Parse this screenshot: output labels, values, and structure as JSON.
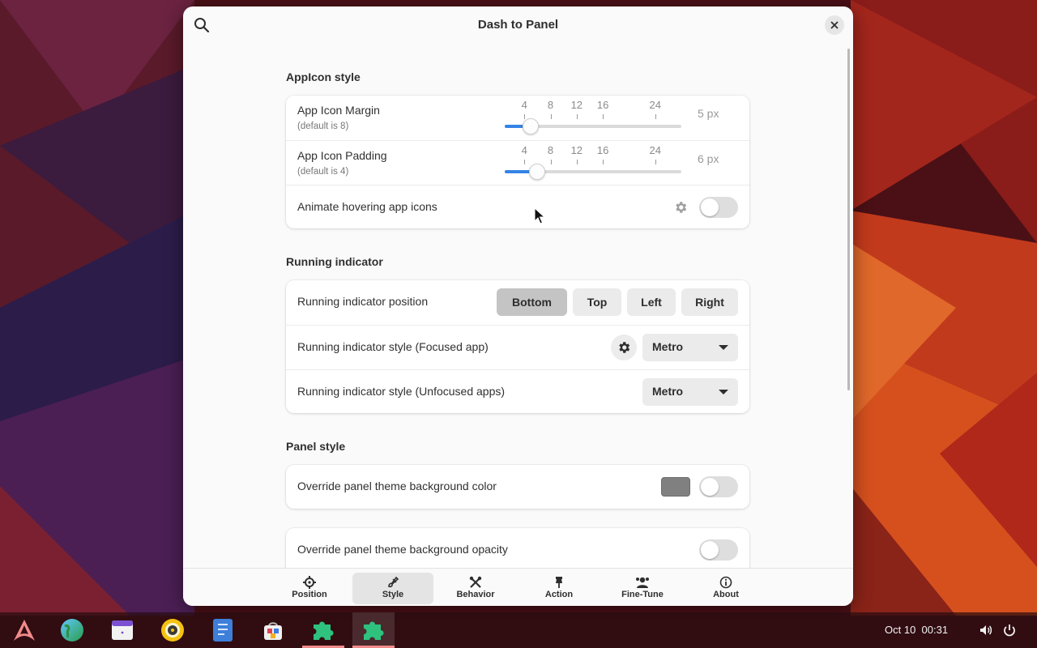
{
  "window": {
    "title": "Dash to Panel"
  },
  "appicon_style": {
    "heading": "AppIcon style",
    "margin": {
      "label": "App Icon Margin",
      "sub": "(default is 8)",
      "value_text": "5 px",
      "value": 5
    },
    "padding": {
      "label": "App Icon Padding",
      "sub": "(default is 4)",
      "value_text": "6 px",
      "value": 6
    },
    "ticks": [
      "4",
      "8",
      "12",
      "16",
      "24"
    ],
    "animate": {
      "label": "Animate hovering app icons",
      "enabled": false
    }
  },
  "running_indicator": {
    "heading": "Running indicator",
    "position": {
      "label": "Running indicator position",
      "options": [
        "Bottom",
        "Top",
        "Left",
        "Right"
      ],
      "selected": "Bottom"
    },
    "focused": {
      "label": "Running indicator style (Focused app)",
      "value": "Metro"
    },
    "unfocused": {
      "label": "Running indicator style (Unfocused apps)",
      "value": "Metro"
    }
  },
  "panel_style": {
    "heading": "Panel style",
    "bg_color": {
      "label": "Override panel theme background color",
      "swatch": "#808080",
      "enabled": false
    },
    "bg_opacity": {
      "label": "Override panel theme background opacity",
      "enabled": false
    }
  },
  "nav": {
    "items": [
      {
        "label": "Position",
        "icon": "crosshair-icon"
      },
      {
        "label": "Style",
        "icon": "brush-icon"
      },
      {
        "label": "Behavior",
        "icon": "tools-icon"
      },
      {
        "label": "Action",
        "icon": "pin-icon"
      },
      {
        "label": "Fine-Tune",
        "icon": "dj-icon"
      },
      {
        "label": "About",
        "icon": "info-icon"
      }
    ],
    "active": "Style"
  },
  "taskbar": {
    "apps": [
      "arch-logo",
      "browser-globe",
      "calendar-app",
      "music-player",
      "text-editor",
      "software-store",
      "extension-puzzle",
      "extension-puzzle-active"
    ],
    "date": "Oct 10",
    "time": "00:31"
  }
}
